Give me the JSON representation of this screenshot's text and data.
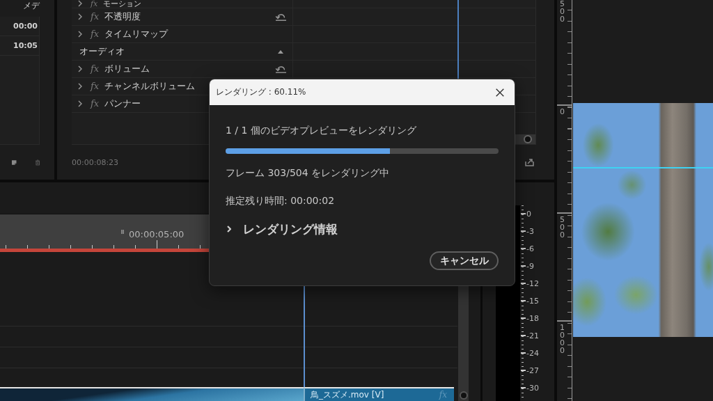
{
  "project_panel": {
    "column_header": "メデ",
    "cells": [
      "00:00",
      "10:05"
    ]
  },
  "effect_controls": {
    "rows": [
      {
        "kind": "effect",
        "badge": "fx",
        "label": "モーション",
        "expanded": false,
        "reset": false
      },
      {
        "kind": "effect",
        "badge": "fx",
        "label": "不透明度",
        "expanded": false,
        "reset": true
      },
      {
        "kind": "effect",
        "badge": "fx",
        "label": "タイムリマップ",
        "expanded": false,
        "reset": false
      },
      {
        "kind": "section",
        "label": "オーディオ",
        "expanded": true
      },
      {
        "kind": "effect",
        "badge": "fx",
        "label": "ボリューム",
        "expanded": false,
        "reset": true
      },
      {
        "kind": "effect",
        "badge": "fx",
        "label": "チャンネルボリューム",
        "expanded": false,
        "reset": false
      },
      {
        "kind": "effect",
        "badge": "fx",
        "label": "パンナー",
        "expanded": false,
        "reset": false
      }
    ],
    "timecode": "00:00:08:23"
  },
  "program_monitor": {
    "ruler_labels": [
      "500",
      "0",
      "500",
      "1000"
    ]
  },
  "timeline": {
    "ruler_timecode": "00:00:05:00",
    "clip": {
      "name": "鳥_スズメ.mov [V]",
      "badge": "fx"
    }
  },
  "audio_meter": {
    "scale": [
      "0",
      "-3",
      "-6",
      "-9",
      "-12",
      "-15",
      "-18",
      "-21",
      "-24",
      "-27",
      "-30"
    ]
  },
  "dialog": {
    "title": "レンダリング : 60.11%",
    "status": "1 / 1 個のビデオプレビューをレンダリング",
    "progress": {
      "level": 0.6011
    },
    "frame_status": "フレーム 303/504 をレンダリング中",
    "time_remaining": "推定残り時間: 00:00:02",
    "details": {
      "label": "レンダリング情報",
      "expanded": false
    },
    "buttons": [
      "キャンセル"
    ]
  }
}
